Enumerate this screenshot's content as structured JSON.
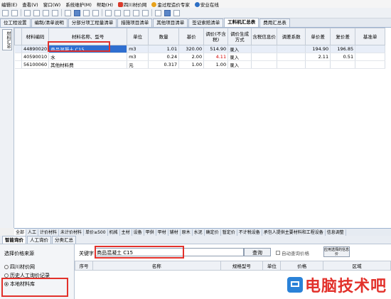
{
  "menubar": {
    "items": [
      "编辑(E)",
      "查看(V)",
      "窗口(W)",
      "系统维护(M)",
      "帮助(H)",
      "四川材价网",
      "金过程造价专家",
      "安业在线"
    ]
  },
  "tabs": [
    "位工程设置",
    "编制/清单说明",
    "分部分项工程量清单",
    "措施项目清单",
    "其他项目清单",
    "签证索赔清单",
    "工料机汇总表",
    "费用汇总表"
  ],
  "active_tab": "工料机汇总表",
  "left_vtab": "材料汇总",
  "grid": {
    "headers": [
      "材料编码",
      "材料名称、型号",
      "单位",
      "数量",
      "基价",
      "调价(不含税)",
      "调价生成方式",
      "含税信息价",
      "调差系数",
      "单价差",
      "复价差",
      "基准单"
    ],
    "rows": [
      {
        "code": "44890020",
        "name": "商品混凝土 C15",
        "unit": "m3",
        "qty": "1.01",
        "base": "320.00",
        "adj": "514.90",
        "method": "录入",
        "tax": "",
        "coef": "",
        "diff": "194.90",
        "rdiff": "196.85"
      },
      {
        "code": "40590010",
        "name": "水",
        "unit": "m3",
        "qty": "0.24",
        "base": "2.00",
        "adj": "4.11",
        "method": "录入",
        "tax": "",
        "coef": "",
        "diff": "2.11",
        "rdiff": "0.51"
      },
      {
        "code": "56100060",
        "name": "其他材料费",
        "unit": "元",
        "qty": "0.317",
        "base": "1.00",
        "adj": "1.00",
        "method": "录入",
        "tax": "",
        "coef": "",
        "diff": "",
        "rdiff": ""
      }
    ]
  },
  "material_tabs": [
    "全部",
    "人工",
    "计价材料",
    "未计价材料",
    "单价≥500",
    "机械",
    "主材",
    "设备",
    "甲供",
    "甲材",
    "辅材",
    "原木",
    "水泥",
    "确定价",
    "暂定价",
    "不计税设备",
    "承包人提供主要材料和工程设备",
    "信息调整"
  ],
  "search_tabs": [
    "智能询价",
    "人工询价",
    "分类汇总"
  ],
  "search": {
    "source_label": "选择价格来源",
    "options": [
      "四川材价网",
      "历史人工询价记录",
      "本地材料库"
    ],
    "selected": 2,
    "keyword_label": "关键字",
    "keyword_value": "商品混凝土 C15",
    "query_button": "查询",
    "auto_query_label": "自动查询价格",
    "apply_button": "应用选择的信息价",
    "result_headers": [
      "序号",
      "名称",
      "规格型号",
      "单位",
      "价格",
      "区域"
    ]
  },
  "watermark": "电脑技术吧",
  "colors": {
    "accent": "#2f6fd0",
    "annotation": "#e2312b"
  }
}
